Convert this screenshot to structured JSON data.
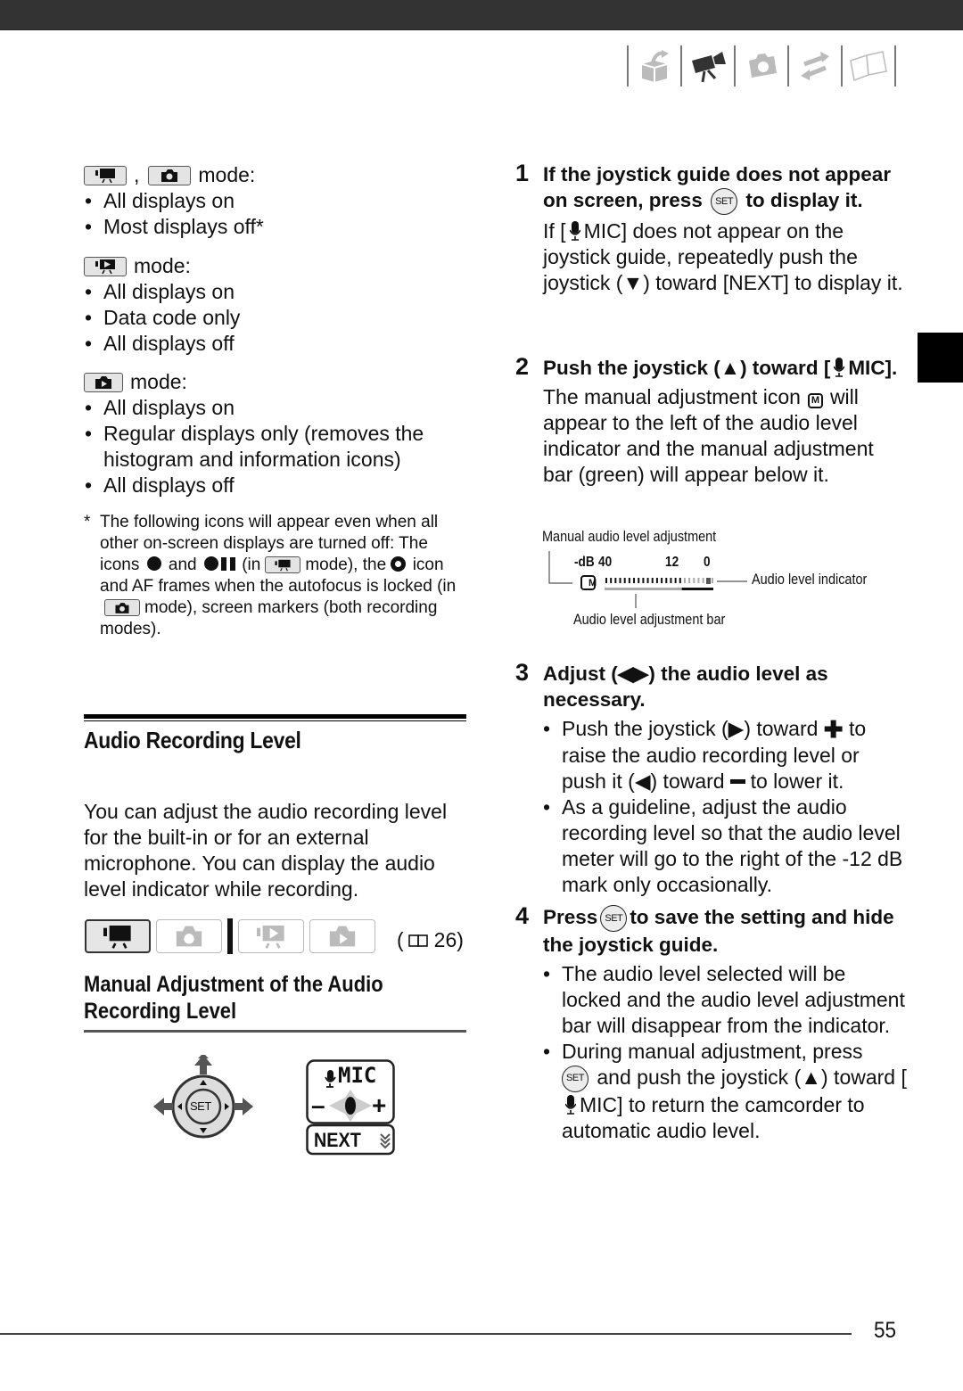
{
  "nav_icons": [
    "getting-started-icon",
    "video-icon",
    "photo-icon",
    "external-connections-icon",
    "reference-book-icon"
  ],
  "left": {
    "group1": {
      "mode_label": "mode:",
      "separator": ",",
      "items": [
        "All displays on",
        "Most displays off*"
      ]
    },
    "group2": {
      "mode_label": "mode:",
      "items": [
        "All displays on",
        "Data code only",
        "All displays off"
      ]
    },
    "group3": {
      "mode_label": "mode:",
      "items": [
        "All displays on",
        "Regular displays only (removes the histogram and information icons)",
        "All displays off"
      ]
    },
    "footnote": {
      "star": "*",
      "line1": "The following icons will appear even when all other on-screen displays are turned off: The icons",
      "and": "and",
      "in_open": "(in",
      "mode_the": "mode), the",
      "icon_af": "icon and AF frames when the autofocus is locked (in",
      "mode_end": "mode), screen markers (both recording modes)."
    },
    "section_title": "Audio Recording Level",
    "intro": "You can adjust the audio recording level for the built-in or for an external microphone. You can display the audio level indicator while recording.",
    "page_ref": "26",
    "mode_tabs": [
      {
        "name": "movie-record",
        "active": true
      },
      {
        "name": "photo-record",
        "active": false
      },
      {
        "name": "movie-playback",
        "active": false
      },
      {
        "name": "photo-playback",
        "active": false
      }
    ],
    "subsection_title": "Manual Adjustment of the Audio Recording Level",
    "joystick": {
      "center_label": "SET"
    },
    "mic_guide": {
      "title": "MIC",
      "minus": "–",
      "plus": "+",
      "next": "NEXT"
    }
  },
  "steps": [
    {
      "num": "1",
      "head_a": "If the joystick guide does not appear on screen, press",
      "head_b": "to display it.",
      "body_a": "If [",
      "body_b": "MIC] does not appear on the joystick guide, repeatedly push the joystick (▼) toward [NEXT] to display it."
    },
    {
      "num": "2",
      "head_a": "Push the joystick (▲) toward [",
      "head_b": "MIC].",
      "body_a": "The manual adjustment icon",
      "body_b": "will appear to the left of the audio level indicator and the manual adjustment bar (green) will appear below it."
    },
    {
      "num": "3",
      "head": "Adjust (◀▶) the audio level as necessary.",
      "b1_a": "Push the joystick (▶) toward",
      "b1_b": "to raise the audio recording level or push it (◀) toward",
      "b1_c": "to lower it.",
      "b2": "As a guideline, adjust the audio recording level so that the audio level meter will go to the right of the -12 dB mark only occasionally."
    },
    {
      "num": "4",
      "head_a": "Press",
      "head_b": "to save the setting and hide the joystick guide.",
      "b1": "The audio level selected will be locked and the audio level adjustment bar will disappear from the indicator.",
      "b2_a": "During manual adjustment, press",
      "b2_b": "and push the joystick (▲) toward [",
      "b2_c": "MIC] to return the camcorder to automatic audio level."
    }
  ],
  "set_label": "SET",
  "m_label": "M",
  "diagram": {
    "label_manual": "Manual audio level adjustment",
    "db_label": "-dB",
    "tick_40": "40",
    "tick_12": "12",
    "tick_0": "0",
    "label_indicator": "Audio level indicator",
    "label_bar": "Audio level adjustment bar",
    "meter_fraction": 0.72
  },
  "page_number": "55"
}
